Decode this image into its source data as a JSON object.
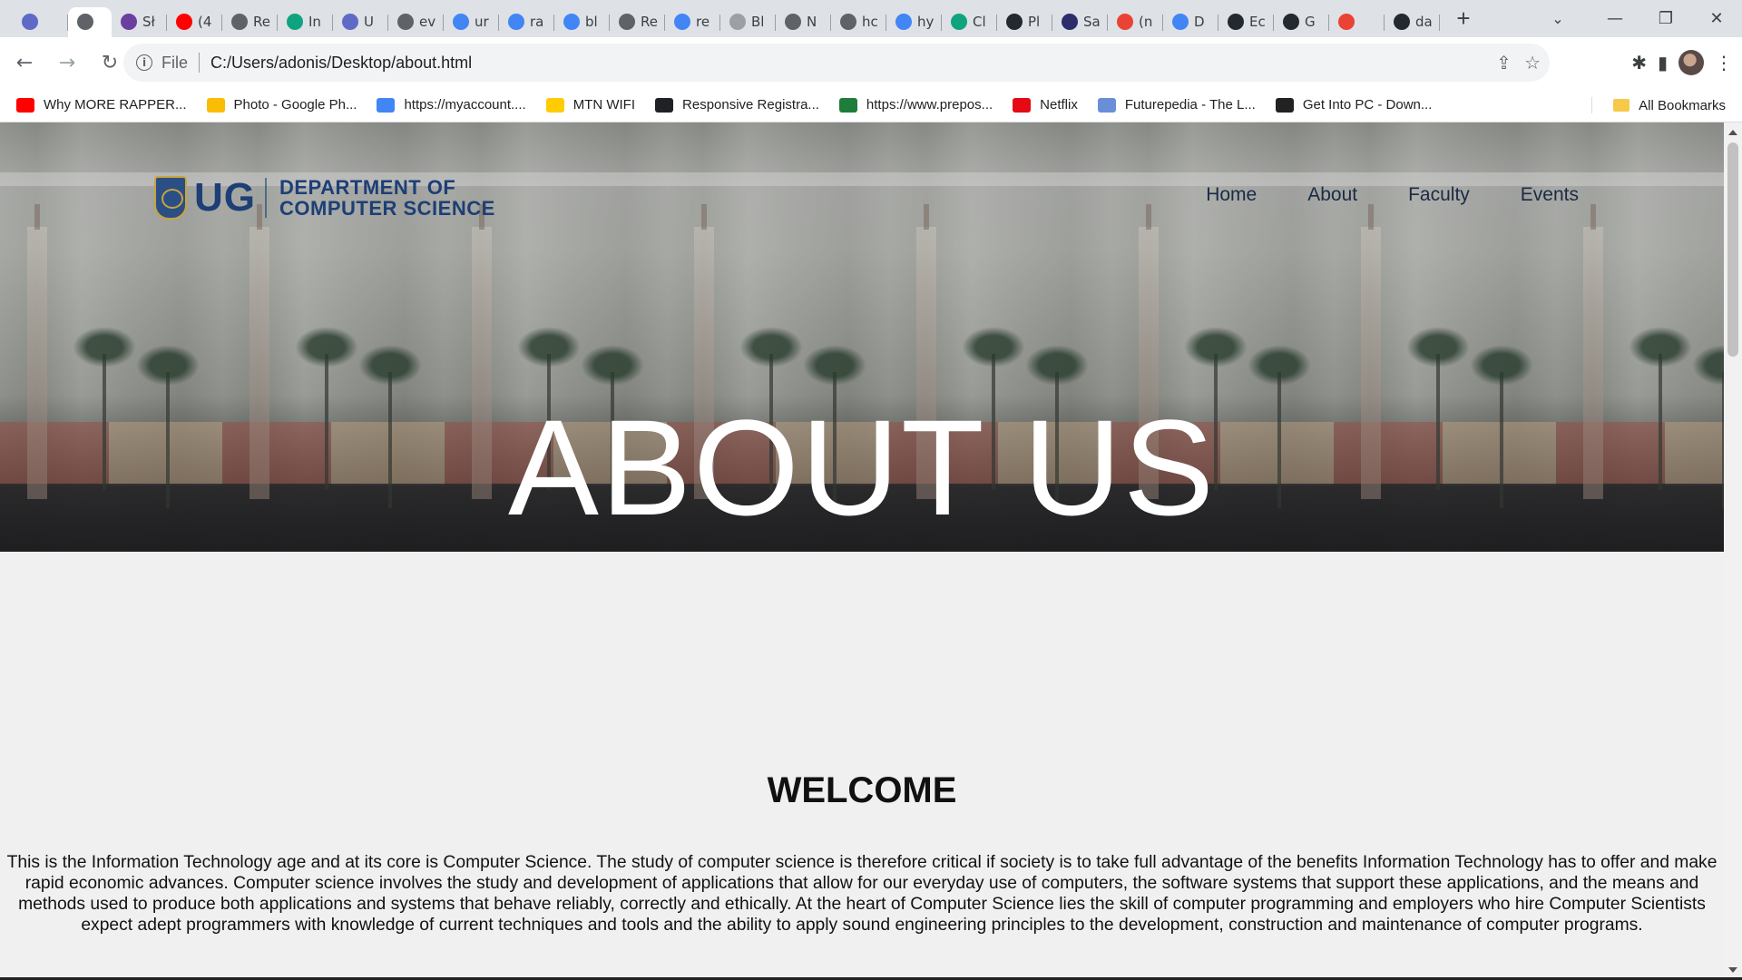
{
  "browser": {
    "tabs": [
      {
        "title": "",
        "icon": "wave-icon",
        "color": "#5f6ac6"
      },
      {
        "title": "",
        "icon": "globe-icon",
        "color": "#5f6368",
        "active": true
      },
      {
        "title": "Sł",
        "icon": "list-icon",
        "color": "#6b3fa0"
      },
      {
        "title": "(4",
        "icon": "youtube-icon",
        "color": "#ff0000"
      },
      {
        "title": "Re",
        "icon": "globe-icon",
        "color": "#5f6368"
      },
      {
        "title": "In",
        "icon": "openai-icon",
        "color": "#10a37f"
      },
      {
        "title": "U",
        "icon": "wave-icon",
        "color": "#5f6ac6"
      },
      {
        "title": "ev",
        "icon": "globe-icon",
        "color": "#5f6368"
      },
      {
        "title": "ur",
        "icon": "google-icon",
        "color": "#4285f4"
      },
      {
        "title": "ra",
        "icon": "google-icon",
        "color": "#4285f4"
      },
      {
        "title": "bl",
        "icon": "google-icon",
        "color": "#4285f4"
      },
      {
        "title": "Re",
        "icon": "globe-icon",
        "color": "#5f6368"
      },
      {
        "title": "re",
        "icon": "google-icon",
        "color": "#4285f4"
      },
      {
        "title": "Bl",
        "icon": "dots-icon",
        "color": "#9aa0a6"
      },
      {
        "title": "N",
        "icon": "globe-icon",
        "color": "#5f6368"
      },
      {
        "title": "hc",
        "icon": "globe-icon",
        "color": "#5f6368"
      },
      {
        "title": "hy",
        "icon": "google-icon",
        "color": "#4285f4"
      },
      {
        "title": "Cl",
        "icon": "openai-icon",
        "color": "#10a37f"
      },
      {
        "title": "Pl",
        "icon": "github-icon",
        "color": "#24292f"
      },
      {
        "title": "Sa",
        "icon": "crest-icon",
        "color": "#2d2d6b"
      },
      {
        "title": "(n",
        "icon": "gmail-icon",
        "color": "#ea4335"
      },
      {
        "title": "D",
        "icon": "docs-icon",
        "color": "#4285f4"
      },
      {
        "title": "Ec",
        "icon": "github-icon",
        "color": "#24292f"
      },
      {
        "title": "G",
        "icon": "github-icon",
        "color": "#24292f"
      },
      {
        "title": "",
        "icon": "gmail-icon",
        "color": "#ea4335"
      },
      {
        "title": "da",
        "icon": "github-icon",
        "color": "#24292f"
      }
    ],
    "new_tab": "+",
    "tab_search": "⌄",
    "window_controls": {
      "minimize": "—",
      "restore": "❐",
      "close": "✕"
    },
    "nav": {
      "back": "←",
      "forward": "→",
      "reload": "↻"
    },
    "address": {
      "scheme": "File",
      "url": "C:/Users/adonis/Desktop/about.html",
      "info": "i"
    },
    "omnibox_actions": {
      "share": "⇪",
      "bookmark": "☆"
    },
    "toolbar_actions": {
      "extensions": "✱",
      "sidepanel": "▮",
      "menu": "⋮"
    },
    "bookmarks": [
      {
        "label": "Why MORE RAPPER...",
        "icon": "youtube-icon",
        "color": "#ff0000"
      },
      {
        "label": "Photo - Google Ph...",
        "icon": "photos-icon",
        "color": "#fbbc05"
      },
      {
        "label": "https://myaccount....",
        "icon": "google-icon",
        "color": "#4285f4"
      },
      {
        "label": "MTN WIFI",
        "icon": "mtn-icon",
        "color": "#ffcc00"
      },
      {
        "label": "Responsive Registra...",
        "icon": "globe-icon",
        "color": "#202124"
      },
      {
        "label": "https://www.prepos...",
        "icon": "prepos-icon",
        "color": "#1e7d3a"
      },
      {
        "label": "Netflix",
        "icon": "netflix-icon",
        "color": "#e50914"
      },
      {
        "label": "Futurepedia - The L...",
        "icon": "futurepedia-icon",
        "color": "#6a8fd8"
      },
      {
        "label": "Get Into PC - Down...",
        "icon": "getintopc-icon",
        "color": "#222222"
      }
    ],
    "all_bookmarks": "All Bookmarks"
  },
  "page": {
    "logo": {
      "abbr": "UG",
      "dept_line1": "DEPARTMENT OF",
      "dept_line2": "COMPUTER SCIENCE"
    },
    "menu": [
      "Home",
      "About",
      "Faculty",
      "Events"
    ],
    "hero_title": "ABOUT US",
    "welcome_heading": "WELCOME",
    "welcome_text": "This is the Information Technology age and at its core is Computer Science. The study of computer science is therefore critical if society is to take full advantage of the benefits Information Technology has to offer and make rapid economic advances. Computer science involves the study and development of applications that allow for our everyday use of computers, the software systems that support these applications, and the means and methods used to produce both applications and systems that behave reliably, correctly and ethically. At the heart of Computer Science lies the skill of computer programming and employers who hire Computer Scientists expect adept programmers with knowledge of current techniques and tools and the ability to apply sound engineering principles to the development, construction and maintenance of computer programs."
  },
  "colors": {
    "brand_blue": "#1d3f75",
    "chrome_bg": "#dee1e6"
  }
}
